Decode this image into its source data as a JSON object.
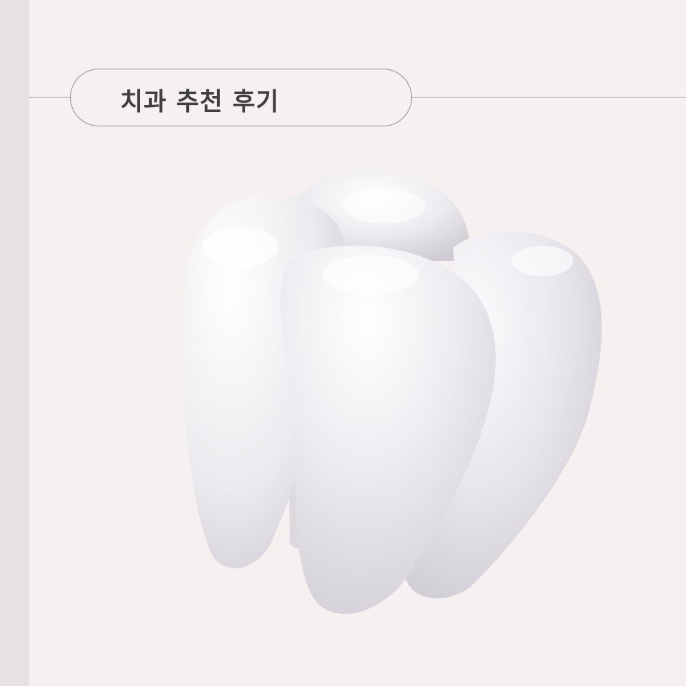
{
  "header": {
    "title": "치과 추천 후기"
  },
  "illustration": {
    "icon": "tooth-icon"
  },
  "colors": {
    "background": "#f7f0f0",
    "side_strip": "#e7e2e2",
    "outline": "#8d8d8d",
    "title_text": "#3f3f3f"
  }
}
